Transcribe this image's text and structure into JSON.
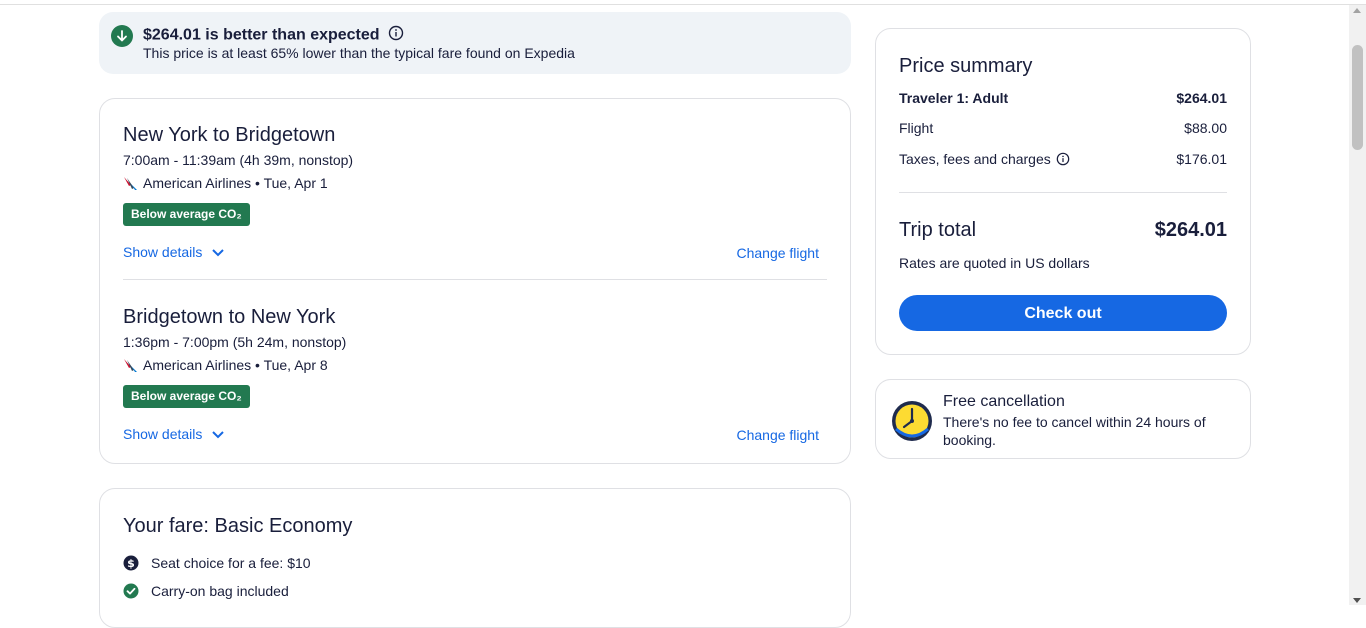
{
  "banner": {
    "title": "$264.01 is better than expected",
    "subtitle": "This price is at least 65% lower than the typical fare found on Expedia"
  },
  "legs": [
    {
      "title": "New York to Bridgetown",
      "times": "7:00am - 11:39am (4h 39m, nonstop)",
      "airline": "American Airlines • Tue, Apr 1",
      "badge": "Below average CO₂",
      "show_details": "Show details",
      "change_flight": "Change flight"
    },
    {
      "title": "Bridgetown to New York",
      "times": "1:36pm - 7:00pm (5h 24m, nonstop)",
      "airline": "American Airlines • Tue, Apr 8",
      "badge": "Below average CO₂",
      "show_details": "Show details",
      "change_flight": "Change flight"
    }
  ],
  "fare": {
    "title": "Your fare: Basic Economy",
    "items": [
      {
        "icon": "dollar-icon",
        "label": "Seat choice for a fee: $10"
      },
      {
        "icon": "check-circle-icon",
        "label": "Carry-on bag included"
      }
    ]
  },
  "price_summary": {
    "title": "Price summary",
    "traveler_label": "Traveler 1: Adult",
    "traveler_amount": "$264.01",
    "flight_label": "Flight",
    "flight_amount": "$88.00",
    "taxes_label": "Taxes, fees and charges",
    "taxes_amount": "$176.01",
    "trip_total_label": "Trip total",
    "trip_total_amount": "$264.01",
    "rates_note": "Rates are quoted in US dollars",
    "checkout_label": "Check out"
  },
  "cancellation": {
    "title": "Free cancellation",
    "text": "There's no fee to cancel within 24 hours of booking."
  },
  "colors": {
    "accent_blue": "#1668e3",
    "green": "#227950",
    "text": "#191e3b",
    "banner_bg": "#eff3f7"
  }
}
